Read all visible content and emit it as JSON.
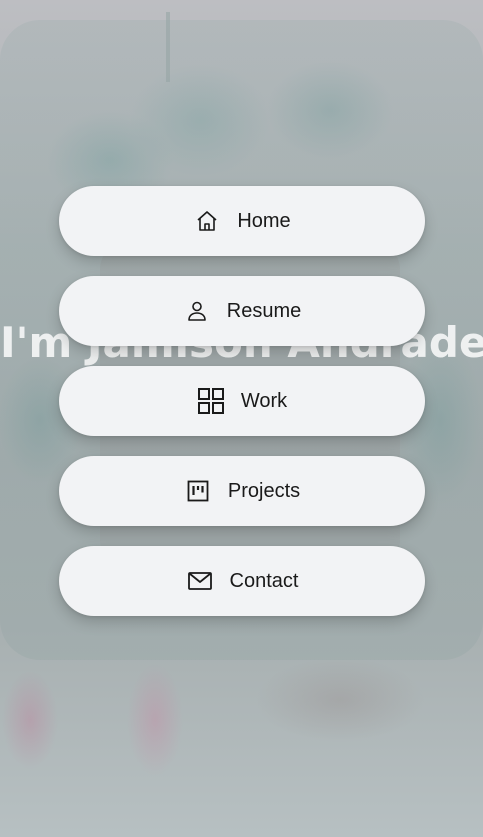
{
  "hero": {
    "title": "I'm Jamison Andrade"
  },
  "nav": {
    "items": [
      {
        "label": "Home",
        "icon": "home-icon"
      },
      {
        "label": "Resume",
        "icon": "person-icon"
      },
      {
        "label": "Work",
        "icon": "grid-icon"
      },
      {
        "label": "Projects",
        "icon": "kanban-icon"
      },
      {
        "label": "Contact",
        "icon": "mail-icon"
      }
    ]
  },
  "colors": {
    "button_bg": "#f2f3f5",
    "text": "#1a1a1a",
    "overlay": "#b8b9bd"
  }
}
